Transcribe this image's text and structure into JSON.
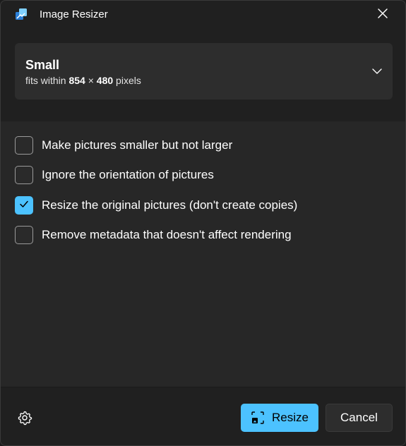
{
  "window": {
    "title": "Image Resizer"
  },
  "size": {
    "name": "Small",
    "desc_prefix": "fits within",
    "width": "854",
    "times": "×",
    "height": "480",
    "unit": "pixels"
  },
  "options": [
    {
      "label": "Make pictures smaller but not larger",
      "checked": false
    },
    {
      "label": "Ignore the orientation of pictures",
      "checked": false
    },
    {
      "label": "Resize the original pictures (don't create copies)",
      "checked": true
    },
    {
      "label": "Remove metadata that doesn't affect rendering",
      "checked": false
    }
  ],
  "footer": {
    "resize_label": "Resize",
    "cancel_label": "Cancel"
  },
  "colors": {
    "accent": "#4cc2ff",
    "background": "#202020",
    "options_background": "#272727",
    "card": "#2d2d2d"
  },
  "icons": {
    "app": "app-icon",
    "close": "close-icon",
    "chevron": "chevron-down-icon",
    "check": "checkmark-icon",
    "settings": "gear-icon",
    "resize": "resize-icon"
  }
}
